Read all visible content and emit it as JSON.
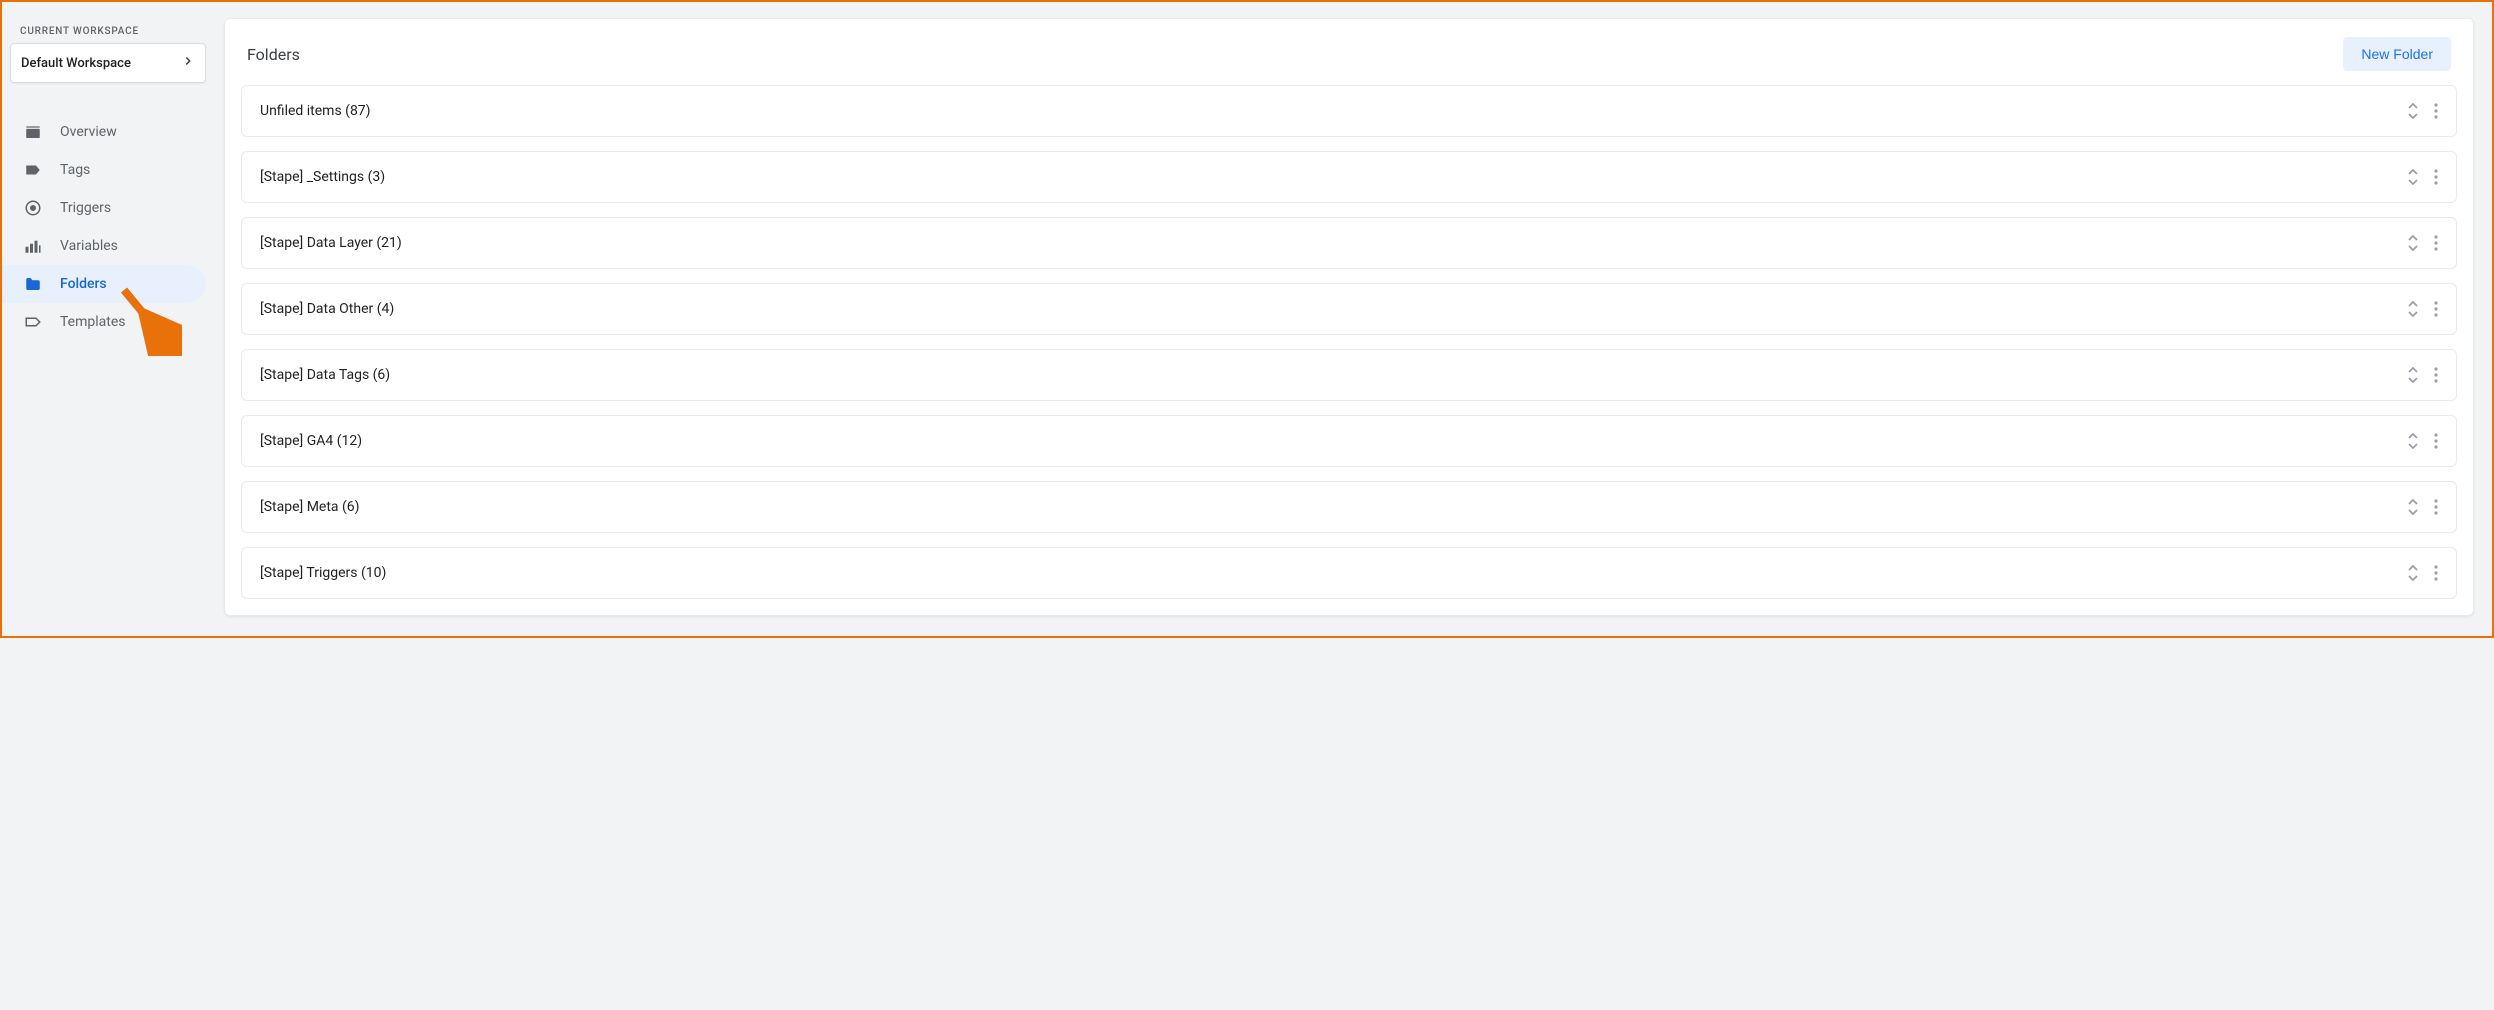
{
  "sidebar": {
    "workspace_label": "CURRENT WORKSPACE",
    "workspace_name": "Default Workspace",
    "nav": [
      {
        "id": "overview",
        "label": "Overview",
        "icon": "overview",
        "active": false
      },
      {
        "id": "tags",
        "label": "Tags",
        "icon": "tag",
        "active": false
      },
      {
        "id": "triggers",
        "label": "Triggers",
        "icon": "target",
        "active": false
      },
      {
        "id": "variables",
        "label": "Variables",
        "icon": "variables",
        "active": false
      },
      {
        "id": "folders",
        "label": "Folders",
        "icon": "folder",
        "active": true
      },
      {
        "id": "templates",
        "label": "Templates",
        "icon": "template",
        "active": false
      }
    ]
  },
  "main": {
    "title": "Folders",
    "new_folder_label": "New Folder",
    "folders": [
      {
        "name": "Unfiled items",
        "count": 87
      },
      {
        "name": "[Stape] _Settings",
        "count": 3
      },
      {
        "name": "[Stape] Data Layer",
        "count": 21
      },
      {
        "name": "[Stape] Data Other",
        "count": 4
      },
      {
        "name": "[Stape] Data Tags",
        "count": 6
      },
      {
        "name": "[Stape] GA4",
        "count": 12
      },
      {
        "name": "[Stape] Meta",
        "count": 6
      },
      {
        "name": "[Stape] Triggers",
        "count": 10
      }
    ]
  }
}
